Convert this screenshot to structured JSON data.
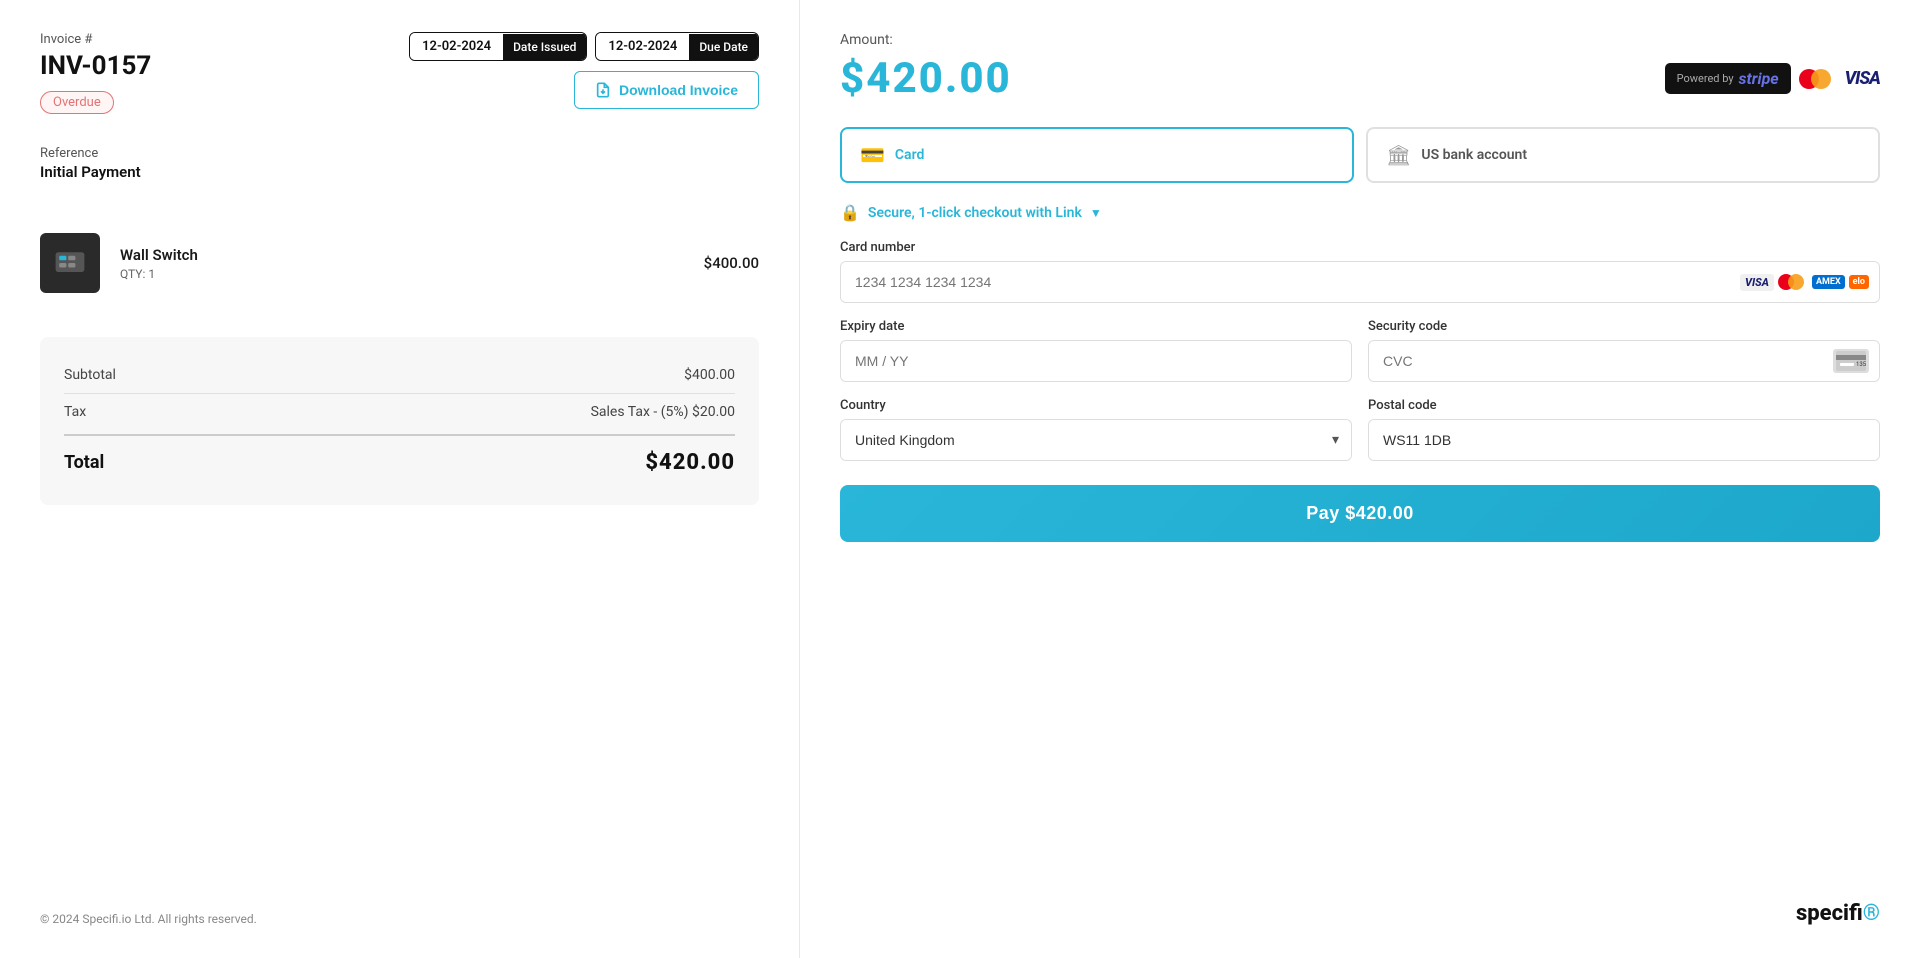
{
  "left": {
    "invoice_label": "Invoice #",
    "invoice_number": "INV-0157",
    "status_badge": "Overdue",
    "date_issued_value": "12-02-2024",
    "date_issued_label": "Date Issued",
    "due_date_value": "12-02-2024",
    "due_date_label": "Due Date",
    "download_button": "Download Invoice",
    "reference_label": "Reference",
    "reference_value": "Initial Payment",
    "product_name": "Wall Switch",
    "product_qty": "QTY: 1",
    "product_price": "$400.00",
    "subtotal_label": "Subtotal",
    "subtotal_value": "$400.00",
    "tax_label": "Tax",
    "tax_detail": "Sales Tax - (5%) $20.00",
    "total_label": "Total",
    "total_value": "$420.00",
    "footer_text": "© 2024 Specifi.io Ltd. All rights reserved."
  },
  "right": {
    "amount_label": "Amount:",
    "amount_value": "$420.00",
    "powered_by": "Powered by",
    "stripe_name": "stripe",
    "tab_card_label": "Card",
    "tab_bank_label": "US bank account",
    "secure_text": "Secure, 1-click checkout with Link",
    "card_number_label": "Card number",
    "card_number_placeholder": "1234 1234 1234 1234",
    "expiry_label": "Expiry date",
    "expiry_placeholder": "MM / YY",
    "security_label": "Security code",
    "security_placeholder": "CVC",
    "country_label": "Country",
    "country_value": "United Kingdom",
    "postal_label": "Postal code",
    "postal_value": "WS11 1DB",
    "pay_button": "Pay  $420.00"
  },
  "footer": {
    "logo_text": "specifi"
  }
}
